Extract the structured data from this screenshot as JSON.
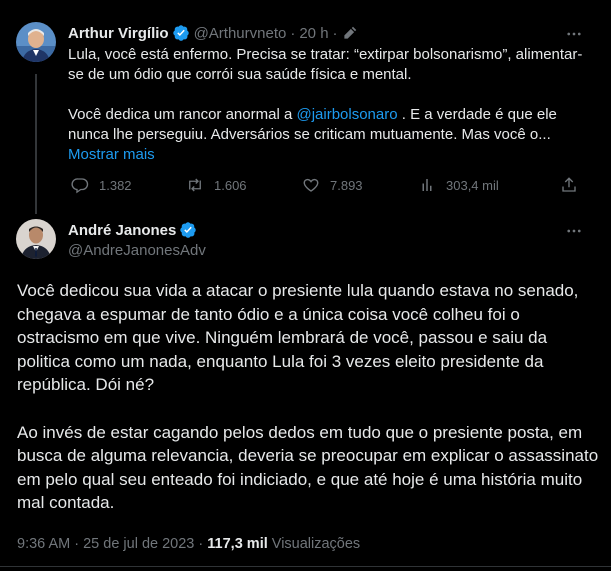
{
  "tweet1": {
    "author_name": "Arthur Virgílio",
    "handle": "@Arthurvneto",
    "separator": "·",
    "time": "20 h",
    "paragraph1": "Lula, você  está enfermo. Precisa se tratar: “extirpar bolsonarismo”, alimentar-se de um ódio que corrói sua saúde física e mental.",
    "paragraph2_before": "Você dedica um rancor anormal a ",
    "mention": "@jairbolsonaro",
    "paragraph2_after": " . E a verdade é que ele nunca lhe perseguiu. Adversários se criticam mutuamente. Mas você o...",
    "show_more": "Mostrar mais",
    "replies": "1.382",
    "retweets": "1.606",
    "likes": "7.893",
    "views": "303,4 mil"
  },
  "tweet2": {
    "author_name": "André Janones",
    "handle": "@AndreJanonesAdv",
    "paragraph1": "Você dedicou sua vida a atacar o presiente lula quando estava no senado, chegava a espumar de tanto ódio e a única coisa você colheu foi o ostracismo em que vive. Ninguém lembrará de você, passou  e saiu da politica como um nada, enquanto Lula foi 3 vezes eleito presidente da república. Dói né?",
    "paragraph2": "Ao invés de estar cagando pelos dedos em tudo que o presiente posta, em busca de alguma relevancia, deveria se preocupar em explicar o assassinato em pelo qual seu enteado foi indiciado, e que até hoje é uma história muito mal contada.",
    "time": "9:36 AM",
    "separator": "·",
    "date": "25 de jul de 2023",
    "separator2": "·",
    "views_count": "117,3 mil",
    "views_label": "Visualizações"
  },
  "colors": {
    "background": "#000000",
    "text": "#e7e9ea",
    "muted": "#71767b",
    "accent": "#1d9bf0",
    "divider": "#2f3336"
  }
}
